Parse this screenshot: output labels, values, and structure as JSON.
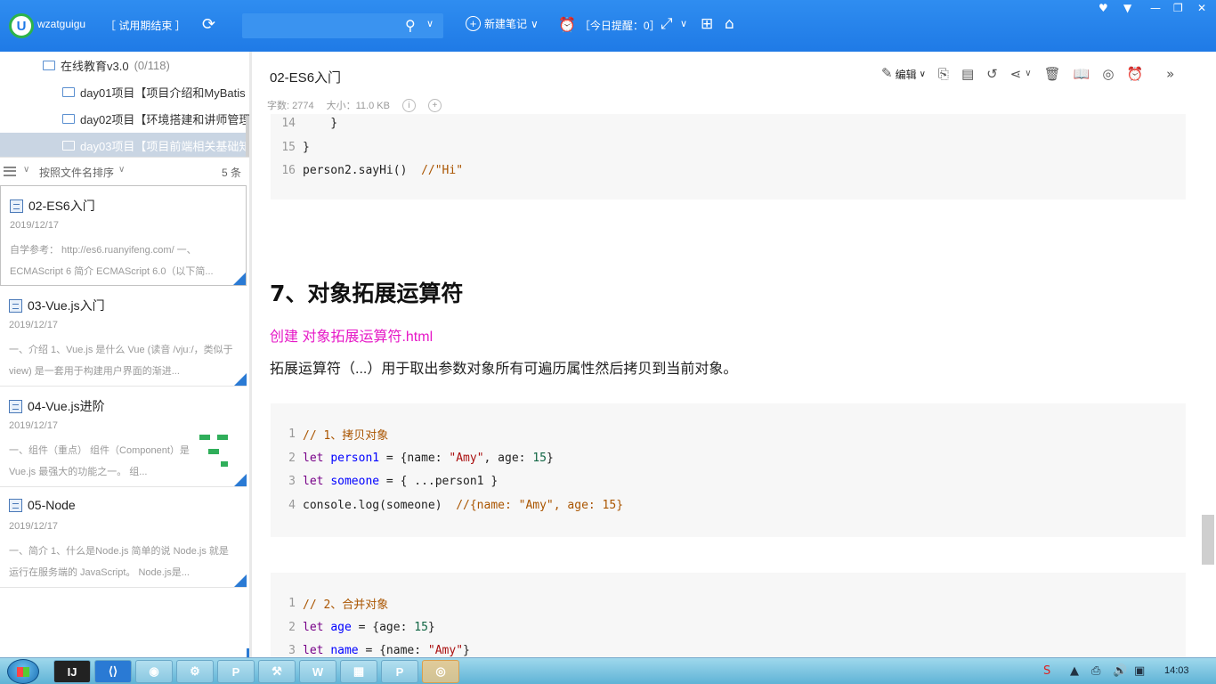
{
  "app": {
    "user_name": "wzatguigu",
    "trial_label": "［ 试用期结束 ］",
    "search_placeholder": "",
    "new_note_label": "新建笔记",
    "reminder_label": "［今日提醒：0］",
    "accent_color": "#1f7ae6"
  },
  "tree": {
    "items": [
      {
        "label": "在线教育v3.0",
        "count": "(0/118)"
      },
      {
        "label": "day01项目【项目介绍和MyBatis"
      },
      {
        "label": "day02项目【环境搭建和讲师管理"
      },
      {
        "label": "day03项目【项目前端相关基础知"
      }
    ]
  },
  "sort": {
    "label": "按照文件名排序",
    "count": "5 条"
  },
  "notes": [
    {
      "title": "02-ES6入门",
      "date": "2019/12/17",
      "snippet": "自学参考： http://es6.ruanyifeng.com/ 一、ECMAScript 6 简介 ECMAScript 6.0（以下简..."
    },
    {
      "title": "03-Vue.js入门",
      "date": "2019/12/17",
      "snippet": "一、介绍 1、Vue.js 是什么 Vue (读音 /vjuː/，类似于 view) 是一套用于构建用户界面的渐进..."
    },
    {
      "title": "04-Vue.js进阶",
      "date": "2019/12/17",
      "snippet": "一、组件（重点） 组件（Component）是 Vue.js 最强大的功能之一。 组..."
    },
    {
      "title": "05-Node",
      "date": "2019/12/17",
      "snippet": "一、简介 1、什么是Node.js 简单的说 Node.js 就是运行在服务端的 JavaScript。 Node.js是..."
    }
  ],
  "note": {
    "title": "02-ES6入门",
    "word_count": "字数: 2774",
    "size": "大小：11.0 KB",
    "edit_label": "编辑",
    "heading": "7、对象拓展运算符",
    "link_text": "创建 对象拓展运算符.html",
    "paragraph": "拓展运算符（...）用于取出参数对象所有可遍历属性然后拷贝到当前对象。"
  },
  "code_top": [
    {
      "n": "14",
      "parts": [
        [
          "plain",
          "    }"
        ]
      ]
    },
    {
      "n": "15",
      "parts": [
        [
          "plain",
          "}"
        ]
      ]
    },
    {
      "n": "16",
      "parts": [
        [
          "plain",
          "person2.sayHi()  "
        ],
        [
          "cm",
          "//\"Hi\""
        ]
      ]
    }
  ],
  "code_mid": [
    {
      "n": "1",
      "parts": [
        [
          "cm",
          "// 1、拷贝对象"
        ]
      ]
    },
    {
      "n": "2",
      "parts": [
        [
          "kw",
          "let "
        ],
        [
          "var",
          "person1"
        ],
        [
          "plain",
          " = {name: "
        ],
        [
          "str",
          "\"Amy\""
        ],
        [
          "plain",
          ", age: "
        ],
        [
          "num",
          "15"
        ],
        [
          "plain",
          "}"
        ]
      ]
    },
    {
      "n": "3",
      "parts": [
        [
          "kw",
          "let "
        ],
        [
          "var",
          "someone"
        ],
        [
          "plain",
          " = { ...person1 }"
        ]
      ]
    },
    {
      "n": "4",
      "parts": [
        [
          "plain",
          "console.log(someone)  "
        ],
        [
          "cm",
          "//{name: \"Amy\", age: 15}"
        ]
      ]
    }
  ],
  "code_bottom": [
    {
      "n": "1",
      "parts": [
        [
          "cm",
          "// 2、合并对象"
        ]
      ]
    },
    {
      "n": "2",
      "parts": [
        [
          "kw",
          "let "
        ],
        [
          "var",
          "age"
        ],
        [
          "plain",
          " = {age: "
        ],
        [
          "num",
          "15"
        ],
        [
          "plain",
          "}"
        ]
      ]
    },
    {
      "n": "3",
      "parts": [
        [
          "kw",
          "let "
        ],
        [
          "var",
          "name"
        ],
        [
          "plain",
          " = {name: "
        ],
        [
          "str",
          "\"Amy\""
        ],
        [
          "plain",
          "}"
        ]
      ]
    }
  ],
  "taskbar": {
    "clock": "14:03"
  }
}
